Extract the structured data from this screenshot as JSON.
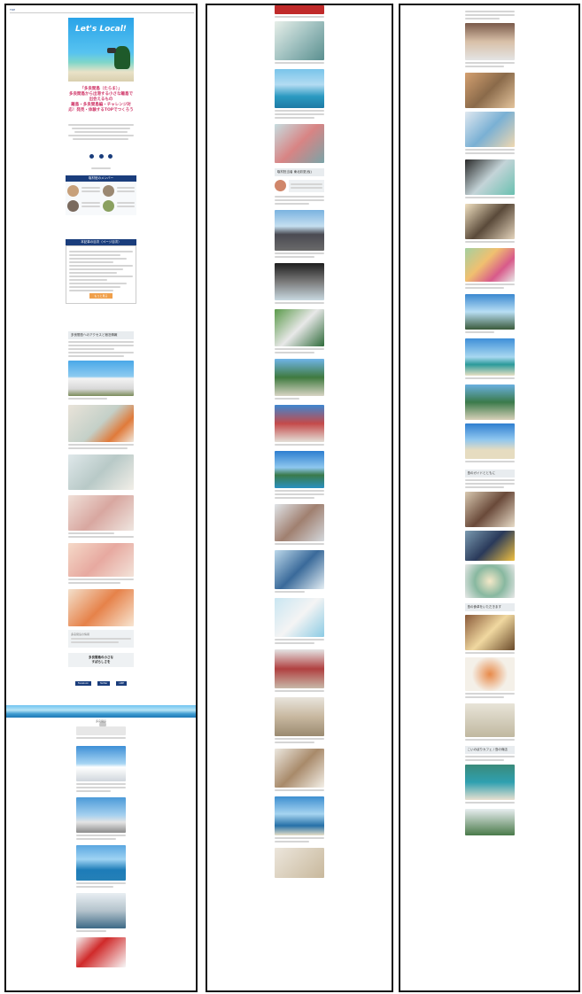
{
  "article": {
    "site_logo": "TOP",
    "hero_title": "Let's Local!",
    "headline_1": "「多良間島（たらま）」",
    "headline_2": "多良間島から出港する小さな離島で出会えるもの",
    "headline_3": "離島・多良間島編・チャレンジ対応！発見・体験するTOPでつくろう",
    "section_members": "取材班のメンバー",
    "section_toc": "本記事の目次（ページ目次）",
    "toc_button": "もっと見る",
    "section_shop": "多良間島へのアクセスと宿泊情報",
    "footer_box_title": "多良間島の情報",
    "share_title": "多良間島の小さな",
    "share_subtitle": "すばらしさを",
    "share_buttons": [
      "Facebook",
      "Twitter",
      "LINE"
    ],
    "ocean_caption": "多良間島",
    "p2_author_section": "取材担当者 東北彩夏(仮)",
    "p3_section_guide": "島のガイドとともに",
    "p3_section_food": "島の食卓をいただきます",
    "p3_section_shop": "こいのぼりカフェ / 島の商店"
  },
  "colors": {
    "navy": "#1a3d7c",
    "accent_pink": "#d03a6b",
    "accent_orange": "#f0a04b",
    "section_gray": "#e8ecef"
  }
}
